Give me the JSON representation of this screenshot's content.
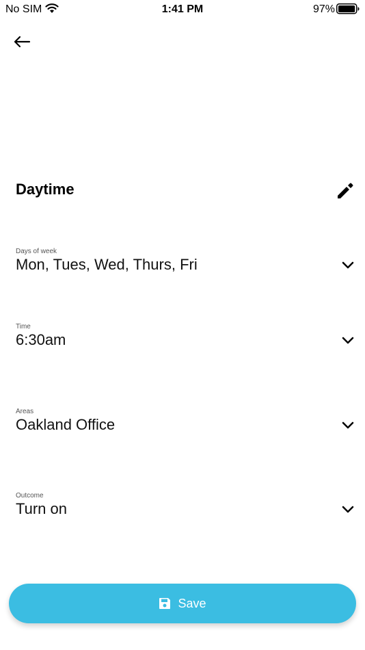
{
  "status_bar": {
    "carrier": "No SIM",
    "time": "1:41 PM",
    "battery": "97%",
    "battery_level": 0.97
  },
  "header": {
    "back_icon": "arrow-left-icon"
  },
  "schedule": {
    "title": "Daytime",
    "edit_icon": "pencil-icon"
  },
  "fields": [
    {
      "label": "Days of week",
      "value": "Mon, Tues, Wed, Thurs, Fri"
    },
    {
      "label": "Time",
      "value": "6:30am"
    },
    {
      "label": "Areas",
      "value": "Oakland Office"
    },
    {
      "label": "Outcome",
      "value": "Turn on"
    }
  ],
  "footer": {
    "save_label": "Save",
    "save_icon": "floppy-disk-icon",
    "accent_color": "#3bbde2"
  }
}
